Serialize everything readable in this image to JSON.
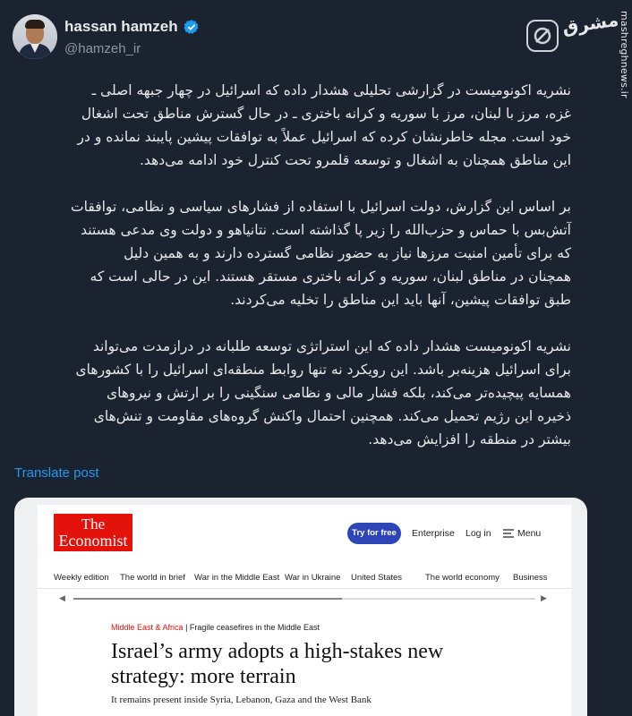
{
  "author": {
    "display_name": "hassan hamzeh",
    "handle": "@hamzeh_ir",
    "verified_icon": "verified-badge-icon"
  },
  "brand": {
    "logo_text": "مشرق",
    "side_url": "mashreghnews.ir",
    "x_icon": "x-logo-icon"
  },
  "tweet": {
    "paragraphs": [
      "نشریه اکونومیست در گزارشی تحلیلی هشدار داده که اسرائیل در چهار جبهه اصلی ـ\nغزه، مرز با لبنان، مرز با سوریه و کرانه باختری ـ در حال گسترش مناطق تحت اشغال\nخود است. مجله خاطرنشان کرده که اسرائیل عملاً به توافقات پیشین پایبند نمانده و در\nاین مناطق همچنان به اشغال و توسعه قلمرو تحت کنترل خود ادامه می‌دهد.",
      "بر اساس این گزارش، دولت اسرائیل با استفاده از فشارهای سیاسی و نظامی، توافقات\nآتش‌بس با حماس و حزب‌الله را زیر پا گذاشته است. نتانیاهو و دولت وی مدعی هستند\nکه برای تأمین امنیت مرزها نیاز به حضور نظامی گسترده دارند و به همین دلیل\nهمچنان در مناطق لبنان، سوریه و کرانه باختری مستقر هستند. این در حالی است که\nطبق توافقات پیشین، آنها باید این مناطق را تخلیه می‌کردند.",
      "نشریه اکونومیست هشدار داده که این استراتژی توسعه طلبانه در درازمدت می‌تواند\nبرای اسرائیل هزینه‌بر باشد. این رویکرد نه تنها روابط منطقه‌ای اسرائیل را با کشورهای\nهمسایه پیچیده‌تر می‌کند، بلکه فشار مالی و نظامی سنگینی را بر ارتش و نیروهای\nذخیره این رژیم تحمیل می‌کند. همچنین احتمال واکنش گروه‌های مقاومت و تنش‌های\nبیشتر در منطقه را افزایش می‌دهد."
    ],
    "translate_label": "Translate post"
  },
  "card": {
    "logo_line1": "The",
    "logo_line2": "Economist",
    "try_label": "Try for free",
    "enterprise_label": "Enterprise",
    "login_label": "Log in",
    "menu_label": "Menu",
    "nav": [
      "Weekly edition",
      "The world in brief",
      "War in the Middle East",
      "War in Ukraine",
      "United States",
      "The world economy",
      "Business",
      "..."
    ],
    "kicker_section": "Middle East & Africa",
    "kicker_topic": "| Fragile ceasefires in the Middle East",
    "headline": "Israel’s army adopts a high-stakes new strategy: more terrain",
    "subhead": "It remains present inside Syria, Lebanon, Gaza and the West Bank",
    "accent_color": "#e3120b",
    "button_color": "#2e45b8"
  }
}
